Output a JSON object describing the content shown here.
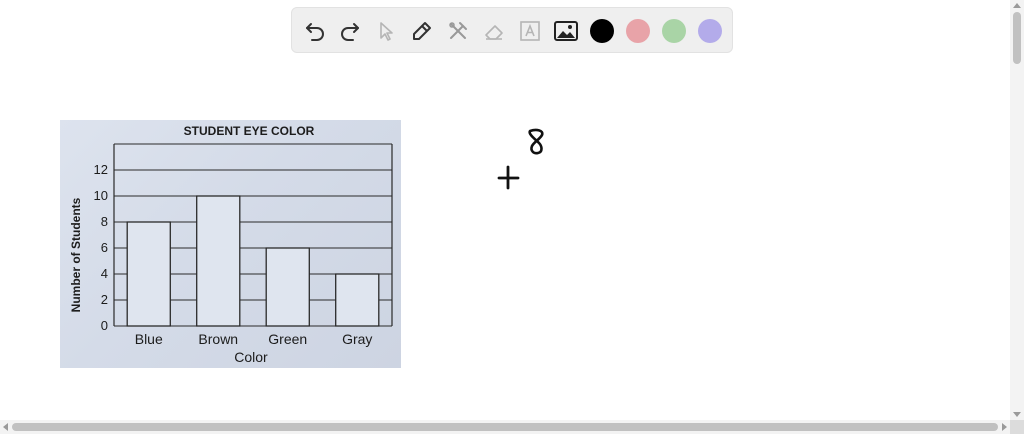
{
  "toolbar": {
    "tools": [
      "undo-icon",
      "redo-icon",
      "select-pointer-icon",
      "pen-icon",
      "shapes-tools-icon",
      "eraser-icon",
      "text-tool-icon",
      "image-insert-icon"
    ],
    "colors": [
      "#000000",
      "#e8a3a8",
      "#a9d4a6",
      "#b3abea"
    ]
  },
  "chart": {
    "title": "STUDENT EYE COLOR",
    "ylabel": "Number of Students",
    "xlabel": "Color"
  },
  "chart_data": {
    "type": "bar",
    "title": "STUDENT EYE COLOR",
    "xlabel": "Color",
    "ylabel": "Number of Students",
    "categories": [
      "Blue",
      "Brown",
      "Green",
      "Gray"
    ],
    "values": [
      8,
      10,
      6,
      4
    ],
    "yticks": [
      "0",
      "2",
      "4",
      "6",
      "8",
      "10",
      "12"
    ],
    "ylim": [
      0,
      14
    ],
    "grid": true
  },
  "handwriting": {
    "top": "8",
    "operator": "+"
  }
}
